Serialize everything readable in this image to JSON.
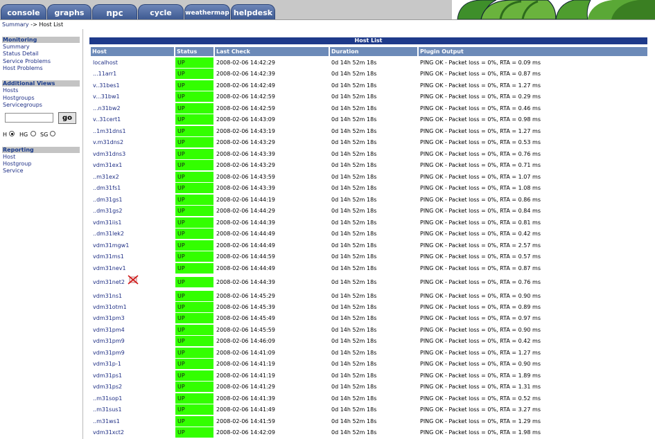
{
  "tabs": [
    {
      "key": "console",
      "label": "console"
    },
    {
      "key": "graphs",
      "label": "graphs"
    },
    {
      "key": "npc",
      "label": "npc"
    },
    {
      "key": "cycle",
      "label": "cycle"
    },
    {
      "key": "weathermap",
      "label": "weathermap"
    },
    {
      "key": "helpdesk",
      "label": "helpdesk"
    }
  ],
  "breadcrumb": {
    "parent": "Summary",
    "separator": "->",
    "current": "Host List"
  },
  "nav": {
    "monitoring": {
      "title": "Monitoring",
      "items": [
        "Summary",
        "Status Detail",
        "Service Problems",
        "Host Problems"
      ]
    },
    "additional_views": {
      "title": "Additional Views",
      "items": [
        "Hosts",
        "Hostgroups",
        "Servicegroups"
      ]
    },
    "search": {
      "value": "",
      "button": "go"
    },
    "radios": [
      {
        "label": "H",
        "checked": true
      },
      {
        "label": "HG",
        "checked": false
      },
      {
        "label": "SG",
        "checked": false
      }
    ],
    "reporting": {
      "title": "Reporting",
      "items": [
        "Host",
        "Hostgroup",
        "Service"
      ]
    }
  },
  "table": {
    "title": "Host List",
    "columns": [
      "Host",
      "Status",
      "Last Check",
      "Duration",
      "Plugin Output"
    ],
    "rows": [
      {
        "host": "localhost",
        "status": "UP",
        "last_check": "2008-02-06 14:42:29",
        "duration": "0d 14h 52m 18s",
        "output": "PING OK - Packet loss = 0%, RTA = 0.09 ms"
      },
      {
        "host": "...11arr1",
        "status": "UP",
        "last_check": "2008-02-06 14:42:39",
        "duration": "0d 14h 52m 18s",
        "output": "PING OK - Packet loss = 0%, RTA = 0.87 ms"
      },
      {
        "host": "v..31bes1",
        "status": "UP",
        "last_check": "2008-02-06 14:42:49",
        "duration": "0d 14h 52m 18s",
        "output": "PING OK - Packet loss = 0%, RTA = 1.27 ms"
      },
      {
        "host": "v...31bw1",
        "status": "UP",
        "last_check": "2008-02-06 14:42:59",
        "duration": "0d 14h 52m 18s",
        "output": "PING OK - Packet loss = 0%, RTA = 0.29 ms"
      },
      {
        "host": "...n31bw2",
        "status": "UP",
        "last_check": "2008-02-06 14:42:59",
        "duration": "0d 14h 52m 18s",
        "output": "PING OK - Packet loss = 0%, RTA = 0.46 ms"
      },
      {
        "host": "v..31cert1",
        "status": "UP",
        "last_check": "2008-02-06 14:43:09",
        "duration": "0d 14h 52m 18s",
        "output": "PING OK - Packet loss = 0%, RTA = 0.98 ms"
      },
      {
        "host": "..1m31dns1",
        "status": "UP",
        "last_check": "2008-02-06 14:43:19",
        "duration": "0d 14h 52m 18s",
        "output": "PING OK - Packet loss = 0%, RTA = 1.27 ms"
      },
      {
        "host": "v.m31dns2",
        "status": "UP",
        "last_check": "2008-02-06 14:43:29",
        "duration": "0d 14h 52m 18s",
        "output": "PING OK - Packet loss = 0%, RTA = 0.53 ms"
      },
      {
        "host": "vdm31dns3",
        "status": "UP",
        "last_check": "2008-02-06 14:43:39",
        "duration": "0d 14h 52m 18s",
        "output": "PING OK - Packet loss = 0%, RTA = 0.76 ms"
      },
      {
        "host": "vdm31ex1",
        "status": "UP",
        "last_check": "2008-02-06 14:43:29",
        "duration": "0d 14h 52m 18s",
        "output": "PING OK - Packet loss = 0%, RTA = 0.71 ms"
      },
      {
        "host": "..m31ex2",
        "status": "UP",
        "last_check": "2008-02-06 14:43:59",
        "duration": "0d 14h 52m 18s",
        "output": "PING OK - Packet loss = 0%, RTA = 1.07 ms"
      },
      {
        "host": "..dm31fs1",
        "status": "UP",
        "last_check": "2008-02-06 14:43:39",
        "duration": "0d 14h 52m 18s",
        "output": "PING OK - Packet loss = 0%, RTA = 1.08 ms"
      },
      {
        "host": "..dm31gs1",
        "status": "UP",
        "last_check": "2008-02-06 14:44:19",
        "duration": "0d 14h 52m 18s",
        "output": "PING OK - Packet loss = 0%, RTA = 0.86 ms"
      },
      {
        "host": "..dm31gs2",
        "status": "UP",
        "last_check": "2008-02-06 14:44:29",
        "duration": "0d 14h 52m 18s",
        "output": "PING OK - Packet loss = 0%, RTA = 0.84 ms"
      },
      {
        "host": "vdm31iis1",
        "status": "UP",
        "last_check": "2008-02-06 14:44:39",
        "duration": "0d 14h 52m 18s",
        "output": "PING OK - Packet loss = 0%, RTA = 0.81 ms"
      },
      {
        "host": "..dm31lek2",
        "status": "UP",
        "last_check": "2008-02-06 14:44:49",
        "duration": "0d 14h 52m 18s",
        "output": "PING OK - Packet loss = 0%, RTA = 0.42 ms"
      },
      {
        "host": "vdm31mgw1",
        "status": "UP",
        "last_check": "2008-02-06 14:44:49",
        "duration": "0d 14h 52m 18s",
        "output": "PING OK - Packet loss = 0%, RTA = 2.57 ms"
      },
      {
        "host": "vdm31ms1",
        "status": "UP",
        "last_check": "2008-02-06 14:44:59",
        "duration": "0d 14h 52m 18s",
        "output": "PING OK - Packet loss = 0%, RTA = 0.57 ms"
      },
      {
        "host": "vdm31nev1",
        "status": "UP",
        "last_check": "2008-02-06 14:44:49",
        "duration": "0d 14h 52m 18s",
        "output": "PING OK - Packet loss = 0%, RTA = 0.87 ms"
      },
      {
        "host": "vdm31net2",
        "status": "UP",
        "last_check": "2008-02-06 14:44:39",
        "duration": "0d 14h 52m 18s",
        "output": "PING OK - Packet loss = 0%, RTA = 0.76 ms",
        "flag": true
      },
      {
        "host": "vdm31ns1",
        "status": "UP",
        "last_check": "2008-02-06 14:45:29",
        "duration": "0d 14h 52m 18s",
        "output": "PING OK - Packet loss = 0%, RTA = 0.90 ms"
      },
      {
        "host": "vdm31otm1",
        "status": "UP",
        "last_check": "2008-02-06 14:45:39",
        "duration": "0d 14h 52m 18s",
        "output": "PING OK - Packet loss = 0%, RTA = 0.89 ms"
      },
      {
        "host": "vdm31pm3",
        "status": "UP",
        "last_check": "2008-02-06 14:45:49",
        "duration": "0d 14h 52m 18s",
        "output": "PING OK - Packet loss = 0%, RTA = 0.97 ms"
      },
      {
        "host": "vdm31pm4",
        "status": "UP",
        "last_check": "2008-02-06 14:45:59",
        "duration": "0d 14h 52m 18s",
        "output": "PING OK - Packet loss = 0%, RTA = 0.90 ms"
      },
      {
        "host": "vdm31pm9",
        "status": "UP",
        "last_check": "2008-02-06 14:46:09",
        "duration": "0d 14h 52m 18s",
        "output": "PING OK - Packet loss = 0%, RTA = 0.42 ms"
      },
      {
        "host": "vdm31pm9",
        "status": "UP",
        "last_check": "2008-02-06 14:41:09",
        "duration": "0d 14h 52m 18s",
        "output": "PING OK - Packet loss = 0%, RTA = 1.27 ms"
      },
      {
        "host": "vdm31p-1",
        "status": "UP",
        "last_check": "2008-02-06 14:41:19",
        "duration": "0d 14h 52m 18s",
        "output": "PING OK - Packet loss = 0%, RTA = 0.90 ms"
      },
      {
        "host": "vdm31ps1",
        "status": "UP",
        "last_check": "2008-02-06 14:41:19",
        "duration": "0d 14h 52m 18s",
        "output": "PING OK - Packet loss = 0%, RTA = 1.89 ms"
      },
      {
        "host": "vdm31ps2",
        "status": "UP",
        "last_check": "2008-02-06 14:41:29",
        "duration": "0d 14h 52m 18s",
        "output": "PING OK - Packet loss = 0%, RTA = 1.31 ms"
      },
      {
        "host": "..m31sop1",
        "status": "UP",
        "last_check": "2008-02-06 14:41:39",
        "duration": "0d 14h 52m 18s",
        "output": "PING OK - Packet loss = 0%, RTA = 0.52 ms"
      },
      {
        "host": "..m31sus1",
        "status": "UP",
        "last_check": "2008-02-06 14:41:49",
        "duration": "0d 14h 52m 18s",
        "output": "PING OK - Packet loss = 0%, RTA = 3.27 ms"
      },
      {
        "host": "..m31ws1",
        "status": "UP",
        "last_check": "2008-02-06 14:41:59",
        "duration": "0d 14h 52m 18s",
        "output": "PING OK - Packet loss = 0%, RTA = 1.29 ms"
      },
      {
        "host": "vdm31xct2",
        "status": "UP",
        "last_check": "2008-02-06 14:42:09",
        "duration": "0d 14h 52m 18s",
        "output": "PING OK - Packet loss = 0%, RTA = 1.98 ms"
      }
    ]
  },
  "colors": {
    "status_up": "#33ff00",
    "header": "#6c8ab8",
    "title_bar": "#1e3a8a",
    "tab": "#4a66a0",
    "link": "#1f2f85"
  }
}
